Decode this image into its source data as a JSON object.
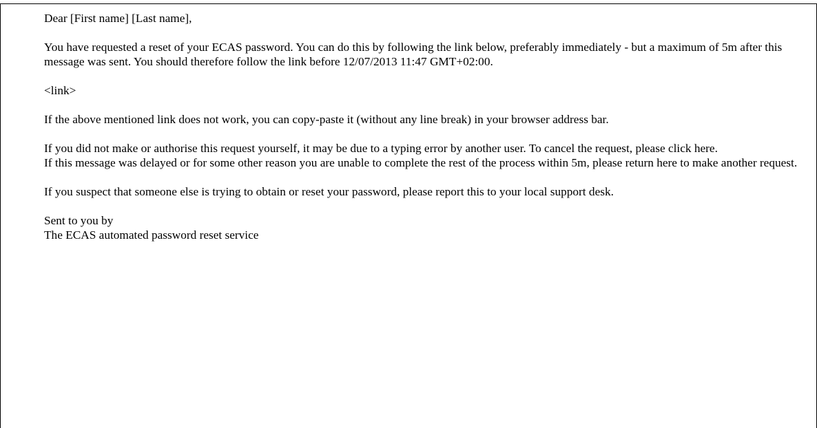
{
  "email": {
    "greeting": "Dear [First name] [Last name],",
    "intro": "You have requested a reset of your ECAS password. You can do this by following the link below, preferably immediately - but a maximum of 5m after this message was sent. You should therefore follow the link before 12/07/2013 11:47 GMT+02:00.",
    "link_placeholder": "<link>",
    "copy_paste": "If the above mentioned link does not work, you can copy-paste it (without any line break) in your browser address bar.",
    "cancel": "If you did not make or authorise this request yourself, it may be due to a typing error by another user. To cancel the request, please click here.",
    "delayed": "If this message was delayed or for some other reason you are unable to complete the rest of the process within 5m, please return here to make another request.",
    "suspect": "If you suspect that someone else is trying to obtain or reset your password, please report this to your local support desk.",
    "signoff_line1": "Sent to you by",
    "signoff_line2": "The ECAS automated password reset service"
  }
}
